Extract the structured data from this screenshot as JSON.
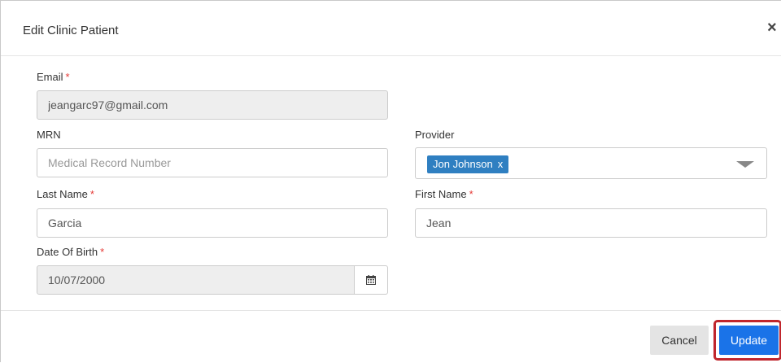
{
  "modal": {
    "title": "Edit Clinic Patient",
    "close_label": "×"
  },
  "fields": {
    "email": {
      "label": "Email",
      "required": "*",
      "value": "jeangarc97@gmail.com"
    },
    "mrn": {
      "label": "MRN",
      "placeholder": "Medical Record Number",
      "value": ""
    },
    "provider": {
      "label": "Provider",
      "selected_tag": "Jon Johnson",
      "tag_remove": "x"
    },
    "last_name": {
      "label": "Last Name",
      "required": "*",
      "value": "Garcia"
    },
    "first_name": {
      "label": "First Name",
      "required": "*",
      "value": "Jean"
    },
    "dob": {
      "label": "Date Of Birth",
      "required": "*",
      "value": "10/07/2000"
    }
  },
  "footer": {
    "cancel_label": "Cancel",
    "update_label": "Update"
  },
  "colors": {
    "required": "#e53935",
    "tag": "#2f7fc1",
    "primary": "#1a73e8",
    "highlight_outline": "#c0262d"
  }
}
